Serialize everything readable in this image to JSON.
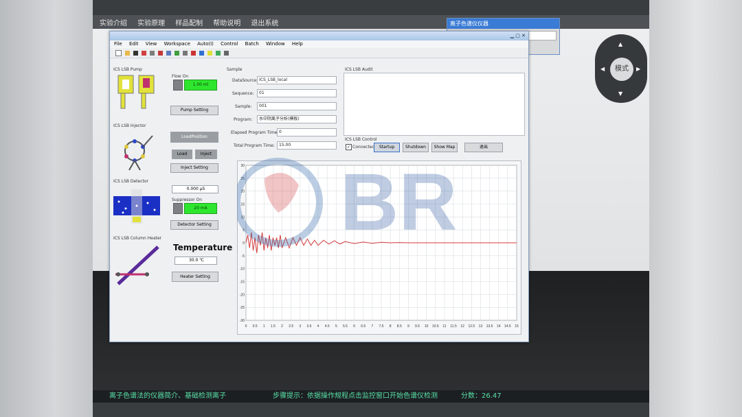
{
  "topbar": {
    "items": [
      "实验介绍",
      "实验原理",
      "样品配制",
      "帮助说明",
      "退出系统"
    ]
  },
  "float_window": {
    "title": "离子色谱仪仪器"
  },
  "nav": {
    "center_label": "模式"
  },
  "app": {
    "menu": [
      "File",
      "Edit",
      "View",
      "Workspace",
      "Auto(I)",
      "Control",
      "Batch",
      "Window",
      "Help"
    ],
    "pump": {
      "section": "ICS LSB Pump",
      "flow_label": "Flow On",
      "flow_value": "1.00 ml",
      "setting_button": "Pump Setting"
    },
    "injector": {
      "section": "ICS LSB Injector",
      "top_button": "LoadPosition",
      "load_button": "Load",
      "inject_button": "Inject",
      "setting_button": "Inject Setting"
    },
    "detector": {
      "section": "ICS LSB Detector",
      "value": "0.000 µS",
      "suppressor_label": "Suppressor On",
      "suppressor_value": "20 mA",
      "setting_button": "Detector Setting"
    },
    "heater": {
      "section": "ICS LSB Column Heater",
      "title": "Temperature",
      "value": "30.0 ℃",
      "setting_button": "Heater Setting"
    },
    "sample": {
      "section": "Sample",
      "fields": [
        {
          "label": "DataSource:",
          "value": "ICS_LSB_local"
        },
        {
          "label": "Sequence:",
          "value": "01"
        },
        {
          "label": "Sample:",
          "value": "001"
        },
        {
          "label": "Program:",
          "value": "水中阴离子分析(模板)"
        },
        {
          "label": "Elapsed Program Time:",
          "value": "0"
        },
        {
          "label": "Total Program Time:",
          "value": "15.00"
        }
      ]
    },
    "audit": {
      "section": "ICS LSB Audit"
    },
    "control": {
      "section": "ICS LSB Control",
      "connected": "Connected",
      "startup": "Startup",
      "shutdown": "Shutdown",
      "show_map": "Show Map",
      "extra": "退出"
    }
  },
  "chart_data": {
    "type": "line",
    "title": "",
    "xlabel": "",
    "ylabel": "",
    "x_ticks": [
      "0",
      "0.5",
      "1",
      "1.5",
      "2",
      "2.5",
      "3",
      "3.5",
      "4",
      "4.5",
      "5",
      "5.5",
      "6",
      "6.5",
      "7",
      "7.5",
      "8",
      "8.5",
      "9",
      "9.5",
      "10",
      "10.5",
      "11",
      "11.5",
      "12",
      "12.5",
      "13",
      "13.5",
      "14",
      "14.5",
      "15"
    ],
    "y_ticks": [
      "30",
      "25",
      "20",
      "15",
      "10",
      "5",
      "0",
      "-5",
      "-10",
      "-15",
      "-20",
      "-25",
      "-30"
    ],
    "xlim": [
      0,
      15
    ],
    "ylim": [
      -30,
      30
    ],
    "grid": true,
    "series": [
      {
        "name": "",
        "color": "#d43a3a",
        "x": [
          0,
          0.1,
          0.2,
          0.3,
          0.4,
          0.5,
          0.6,
          0.7,
          0.8,
          0.9,
          1,
          1.1,
          1.2,
          1.3,
          1.4,
          1.5,
          1.6,
          1.7,
          1.8,
          1.9,
          2,
          2.2,
          2.4,
          2.6,
          2.8,
          3,
          3.2,
          3.4,
          3.6,
          3.8,
          4,
          4.3,
          4.6,
          4.9,
          5.2,
          5.5,
          6,
          6.5,
          7,
          7.5,
          8,
          8.5,
          9,
          9.5,
          10,
          10.5,
          11,
          11.5,
          12,
          12.5,
          13,
          13.5,
          14,
          14.5,
          15
        ],
        "y": [
          0,
          3,
          -2,
          4,
          -3,
          2,
          -4,
          3,
          -1,
          4,
          -3,
          2,
          -2,
          3,
          -3,
          2,
          -1,
          2,
          -2,
          3,
          -2,
          2,
          -2,
          2,
          -1,
          2,
          -1,
          1.5,
          -1,
          1,
          -1,
          1,
          -0.5,
          0.8,
          -0.5,
          0.5,
          -0.3,
          0.3,
          -0.2,
          0.2,
          0,
          0.1,
          0,
          0,
          0,
          0,
          0,
          0,
          0,
          0,
          0,
          0,
          0,
          0,
          0
        ]
      }
    ]
  },
  "statusbar": {
    "left": "离子色谱法的仪器简介、基础检测离子",
    "center": "步骤提示：依据操作规程点击监控窗口开始色谱仪检测",
    "right": "分数：26.47"
  }
}
